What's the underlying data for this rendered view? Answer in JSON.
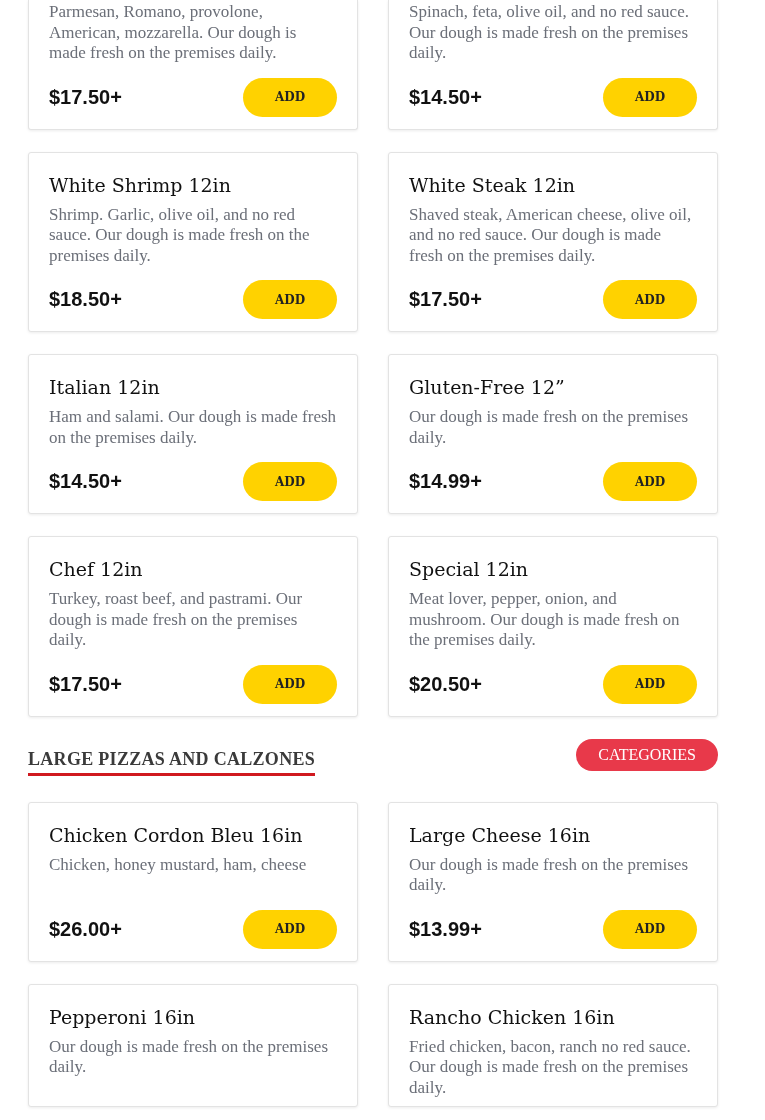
{
  "groups": [
    {
      "items": [
        {
          "description": "Parmesan, Romano, provolone, American, mozzarella. Our dough is made fresh on the premises daily.",
          "price": "$17.50+",
          "button": "ADD"
        },
        {
          "description": "Spinach, feta, olive oil, and no red sauce. Our dough is made fresh on the premises daily.",
          "price": "$14.50+",
          "button": "ADD"
        },
        {
          "title": "White Shrimp 12in",
          "description": "Shrimp. Garlic, olive oil, and no red sauce. Our dough is made fresh on the premises daily.",
          "price": "$18.50+",
          "button": "ADD"
        },
        {
          "title": "White Steak 12in",
          "description": "Shaved steak, American cheese, olive oil, and no red sauce. Our dough is made fresh on the premises daily.",
          "price": "$17.50+",
          "button": "ADD"
        },
        {
          "title": "Italian 12in",
          "description": "Ham and salami. Our dough is made fresh on the premises daily.",
          "price": "$14.50+",
          "button": "ADD"
        },
        {
          "title": "Gluten-Free 12”",
          "description": "Our dough is made fresh on the premises daily.",
          "price": "$14.99+",
          "button": "ADD"
        },
        {
          "title": "Chef 12in",
          "description": "Turkey, roast beef, and pastrami. Our dough is made fresh on the premises daily.",
          "price": "$17.50+",
          "button": "ADD"
        },
        {
          "title": "Special 12in",
          "description": "Meat lover, pepper, onion, and mushroom. Our dough is made fresh on the premises daily.",
          "price": "$20.50+",
          "button": "ADD"
        }
      ]
    },
    {
      "heading": "LARGE PIZZAS AND CALZONES",
      "button": "CATEGORIES",
      "items": [
        {
          "title": "Chicken Cordon Bleu 16in",
          "description": "Chicken, honey mustard, ham, cheese",
          "price": "$26.00+",
          "button": "ADD"
        },
        {
          "title": "Large Cheese 16in",
          "description": "Our dough is made fresh on the premises daily.",
          "price": "$13.99+",
          "button": "ADD"
        },
        {
          "title": "Pepperoni 16in",
          "description": "Our dough is made fresh on the premises daily."
        },
        {
          "title": "Rancho Chicken 16in",
          "description": "Fried chicken, bacon, ranch no red sauce. Our dough is made fresh on the premises daily."
        }
      ]
    }
  ]
}
